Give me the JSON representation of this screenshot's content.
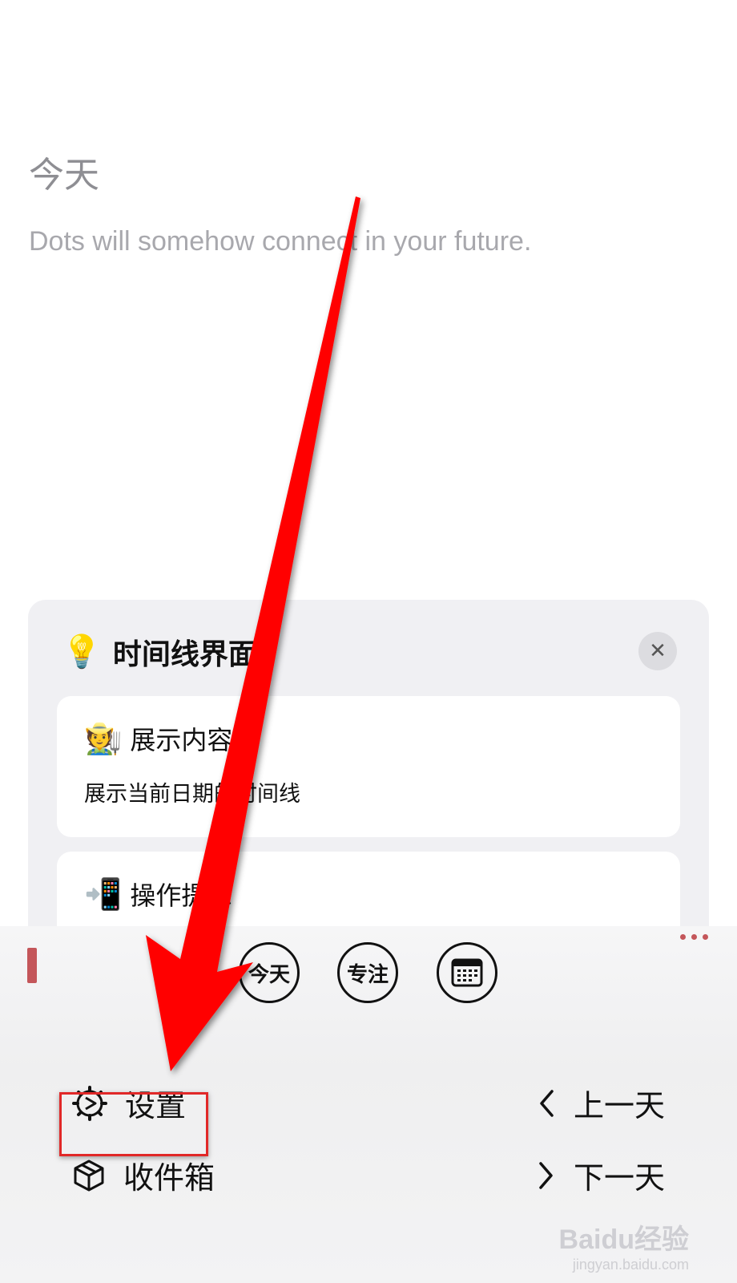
{
  "header": {
    "title": "今天",
    "motto": "Dots will somehow connect in your future."
  },
  "tip_card": {
    "icon": "lightbulb-icon",
    "title": "时间线界面",
    "close_label": "✕",
    "items": [
      {
        "emoji": "🧑‍🌾",
        "title": "展示内容",
        "desc": "展示当前日期的时间线"
      },
      {
        "emoji": "📲",
        "title": "操作提示"
      }
    ]
  },
  "toolbar": {
    "today_label": "今天",
    "focus_label": "专注"
  },
  "menu": {
    "settings_label": "设置",
    "inbox_label": "收件箱",
    "prev_label": "上一天",
    "next_label": "下一天"
  },
  "watermark": {
    "top": "Baidu经验",
    "bottom": "jingyan.baidu.com"
  },
  "colors": {
    "accent_red": "#c4565a",
    "arrow_red": "#ff0000",
    "highlight_red": "#e12828"
  }
}
